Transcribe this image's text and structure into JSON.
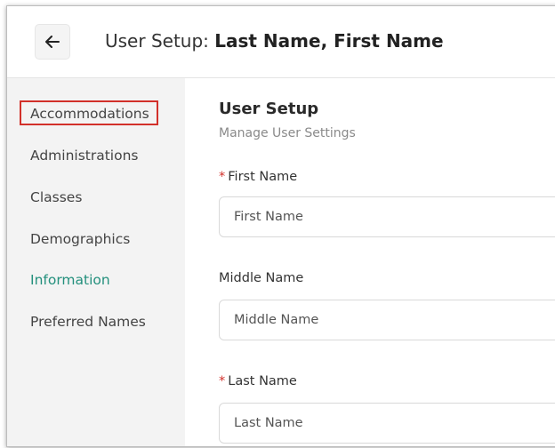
{
  "header": {
    "title_prefix": "User Setup: ",
    "title_name": "Last Name, First Name"
  },
  "sidebar": {
    "items": [
      {
        "label": "Accommodations",
        "state": "highlighted"
      },
      {
        "label": "Administrations",
        "state": "normal"
      },
      {
        "label": "Classes",
        "state": "normal"
      },
      {
        "label": "Demographics",
        "state": "normal"
      },
      {
        "label": "Information",
        "state": "active"
      },
      {
        "label": "Preferred Names",
        "state": "normal"
      }
    ]
  },
  "main": {
    "title": "User Setup",
    "subtitle": "Manage User Settings",
    "fields": [
      {
        "label": "First Name",
        "required": true,
        "placeholder": "First Name"
      },
      {
        "label": "Middle Name",
        "required": false,
        "placeholder": "Middle Name"
      },
      {
        "label": "Last Name",
        "required": true,
        "placeholder": "Last Name"
      }
    ]
  },
  "required_marker": "*",
  "colors": {
    "accent": "#24907d",
    "highlight_border": "#d2302a",
    "required": "#d2302a",
    "sidebar_bg": "#f3f3f3"
  },
  "icons": {
    "back": "arrow-left-icon"
  }
}
